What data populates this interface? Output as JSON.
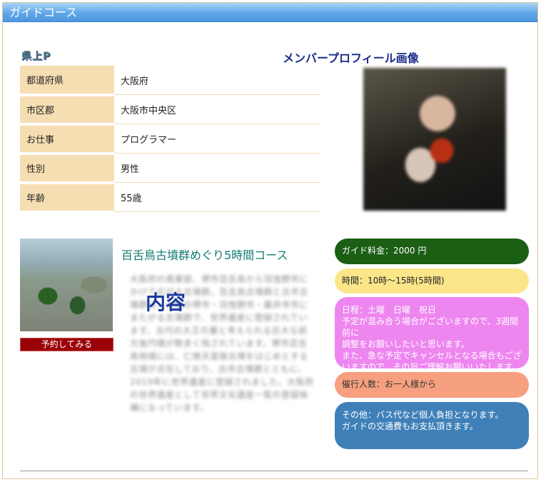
{
  "window": {
    "title": "ガイドコース"
  },
  "profile": {
    "logo_text": "県上P",
    "image_title": "メンバープロフィール画像",
    "rows": [
      {
        "label": "都道府県",
        "value": "大阪府"
      },
      {
        "label": "市区郡",
        "value": "大阪市中央区"
      },
      {
        "label": "お仕事",
        "value": "プログラマー"
      },
      {
        "label": "性別",
        "value": "男性"
      },
      {
        "label": "年齢",
        "value": "55歳"
      }
    ]
  },
  "course": {
    "title": "百舌鳥古墳群めぐり5時間コース",
    "content_label": "内容",
    "reserve_label": "予約してみる",
    "blurred_text": "大阪府の南東部、堺市百舌鳥から羽曳野市にかけて広がる古墳群。百舌鳥古墳群と古市古墳群は、大阪の堺市・羽曳野市・藤井寺市にまたがる古墳群で、世界遺産に登録されています。古代の大王の墓と考えられる巨大な前方後円墳が数多く残されています。堺市百舌鳥地域には、仁徳天皇陵古墳をはじめとする古墳が点在しており、古市古墳群とともに、2019年に世界遺産に登録されました。大阪府の世界遺産として世界文化遺産一覧の登録候補になっています。"
  },
  "info": {
    "fee": "ガイド料金：2000 円",
    "time": "時間：10時～15時(5時間)",
    "schedule_lines": [
      "日程：土曜　日曜　祝日",
      "予定が混み合う場合がございますので、3週間前に",
      "調整をお願いしたいと思います。",
      "また、急な予定でキャンセルとなる場合もござ",
      "いますので、その旨ご理解お願いいたします。"
    ],
    "people": "催行人数：お一人様から",
    "other_lines": [
      "その他：バス代など個人負担となります。",
      "ガイドの交通費もお支払頂きます。"
    ]
  }
}
